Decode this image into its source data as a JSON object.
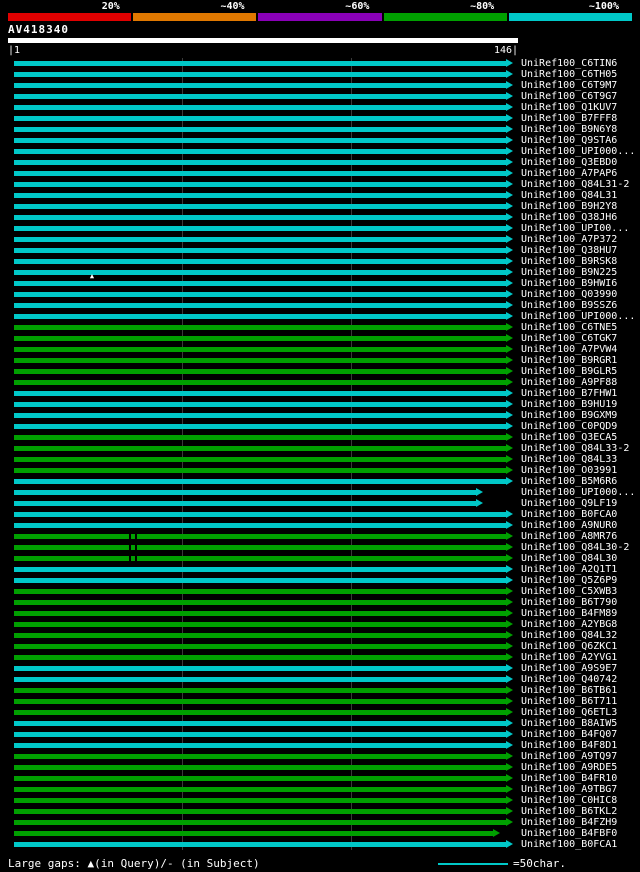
{
  "scale": {
    "labels": [
      "20%",
      "~40%",
      "~60%",
      "~80%",
      "~100%"
    ],
    "colors": [
      "#e00000",
      "#e07800",
      "#8a00b8",
      "#00a000",
      "#00c8c8"
    ]
  },
  "query": {
    "name": "AV418340",
    "ruler_left": "|1",
    "ruler_right": "146|",
    "length": 146
  },
  "bar_colors": {
    "~100%": "#00c8c8",
    "~80%": "#00a000"
  },
  "footer": {
    "gaps_note": "Large gaps: ▲(in Query)/- (in Subject)",
    "legend_label": "=50char.",
    "legend_line_color": "#00c8c8"
  },
  "chart_data": {
    "type": "bar",
    "title": "AV418340",
    "xlabel": "",
    "x_range": [
      1,
      146
    ],
    "grid_ticks": [
      50,
      100
    ],
    "legend_position": "top",
    "identity_bins": [
      "20%",
      "~40%",
      "~60%",
      "~80%",
      "~100%"
    ],
    "rows": [
      {
        "label": "UniRef100_C6TIN6",
        "identity_bin": "~100%",
        "start": 1,
        "end": 146
      },
      {
        "label": "UniRef100_C6TH05",
        "identity_bin": "~100%",
        "start": 1,
        "end": 146
      },
      {
        "label": "UniRef100_C6T9M7",
        "identity_bin": "~100%",
        "start": 1,
        "end": 146
      },
      {
        "label": "UniRef100_C6T9G7",
        "identity_bin": "~100%",
        "start": 1,
        "end": 146
      },
      {
        "label": "UniRef100_Q1KUV7",
        "identity_bin": "~100%",
        "start": 1,
        "end": 146
      },
      {
        "label": "UniRef100_B7FFF8",
        "identity_bin": "~100%",
        "start": 1,
        "end": 146
      },
      {
        "label": "UniRef100_B9N6Y8",
        "identity_bin": "~100%",
        "start": 1,
        "end": 146
      },
      {
        "label": "UniRef100_Q9STA6",
        "identity_bin": "~100%",
        "start": 1,
        "end": 146
      },
      {
        "label": "UniRef100_UPI000...",
        "identity_bin": "~100%",
        "start": 1,
        "end": 146
      },
      {
        "label": "UniRef100_Q3EBD0",
        "identity_bin": "~100%",
        "start": 1,
        "end": 146
      },
      {
        "label": "UniRef100_A7PAP6",
        "identity_bin": "~100%",
        "start": 1,
        "end": 146
      },
      {
        "label": "UniRef100_Q84L31-2",
        "identity_bin": "~100%",
        "start": 1,
        "end": 146
      },
      {
        "label": "UniRef100_Q84L31",
        "identity_bin": "~100%",
        "start": 1,
        "end": 146
      },
      {
        "label": "UniRef100_B9H2Y8",
        "identity_bin": "~100%",
        "start": 1,
        "end": 146
      },
      {
        "label": "UniRef100_Q38JH6",
        "identity_bin": "~100%",
        "start": 1,
        "end": 146
      },
      {
        "label": "UniRef100_UPI00...",
        "identity_bin": "~100%",
        "start": 1,
        "end": 146
      },
      {
        "label": "UniRef100_A7P372",
        "identity_bin": "~100%",
        "start": 1,
        "end": 146
      },
      {
        "label": "UniRef100_Q38HU7",
        "identity_bin": "~100%",
        "start": 1,
        "end": 146
      },
      {
        "label": "UniRef100_B9RSK8",
        "identity_bin": "~100%",
        "start": 1,
        "end": 146
      },
      {
        "label": "UniRef100_B9N225",
        "identity_bin": "~100%",
        "start": 1,
        "end": 146,
        "query_gap_at": 23
      },
      {
        "label": "UniRef100_B9HWI6",
        "identity_bin": "~100%",
        "start": 1,
        "end": 146
      },
      {
        "label": "UniRef100_Q03990",
        "identity_bin": "~100%",
        "start": 1,
        "end": 146
      },
      {
        "label": "UniRef100_B9SSZ6",
        "identity_bin": "~100%",
        "start": 1,
        "end": 146
      },
      {
        "label": "UniRef100_UPI000...",
        "identity_bin": "~100%",
        "start": 1,
        "end": 146
      },
      {
        "label": "UniRef100_C6TNE5",
        "identity_bin": "~80%",
        "start": 1,
        "end": 146
      },
      {
        "label": "UniRef100_C6TGK7",
        "identity_bin": "~80%",
        "start": 1,
        "end": 146
      },
      {
        "label": "UniRef100_A7PVW4",
        "identity_bin": "~80%",
        "start": 1,
        "end": 146
      },
      {
        "label": "UniRef100_B9RGR1",
        "identity_bin": "~80%",
        "start": 1,
        "end": 146
      },
      {
        "label": "UniRef100_B9GLR5",
        "identity_bin": "~80%",
        "start": 1,
        "end": 146
      },
      {
        "label": "UniRef100_A9PF88",
        "identity_bin": "~80%",
        "start": 1,
        "end": 146
      },
      {
        "label": "UniRef100_B7FHW1",
        "identity_bin": "~100%",
        "start": 1,
        "end": 146
      },
      {
        "label": "UniRef100_B9HU19",
        "identity_bin": "~100%",
        "start": 1,
        "end": 146
      },
      {
        "label": "UniRef100_B9GXM9",
        "identity_bin": "~100%",
        "start": 1,
        "end": 146
      },
      {
        "label": "UniRef100_C0PQD9",
        "identity_bin": "~100%",
        "start": 1,
        "end": 146
      },
      {
        "label": "UniRef100_Q3ECA5",
        "identity_bin": "~80%",
        "start": 1,
        "end": 146
      },
      {
        "label": "UniRef100_Q84L33-2",
        "identity_bin": "~80%",
        "start": 1,
        "end": 146
      },
      {
        "label": "UniRef100_Q84L33",
        "identity_bin": "~80%",
        "start": 1,
        "end": 146
      },
      {
        "label": "UniRef100_O03991",
        "identity_bin": "~80%",
        "start": 1,
        "end": 146
      },
      {
        "label": "UniRef100_B5M6R6",
        "identity_bin": "~100%",
        "start": 1,
        "end": 146
      },
      {
        "label": "UniRef100_UPI000...",
        "identity_bin": "~100%",
        "start": 1,
        "end": 137
      },
      {
        "label": "UniRef100_Q9LF19",
        "identity_bin": "~100%",
        "start": 1,
        "end": 137
      },
      {
        "label": "UniRef100_B0FCA0",
        "identity_bin": "~100%",
        "start": 1,
        "end": 146
      },
      {
        "label": "UniRef100_A9NUR0",
        "identity_bin": "~100%",
        "start": 1,
        "end": 146
      },
      {
        "label": "UniRef100_A8MR76",
        "identity_bin": "~80%",
        "start": 1,
        "end": 146,
        "subject_gaps": [
          34,
          36
        ]
      },
      {
        "label": "UniRef100_Q84L30-2",
        "identity_bin": "~80%",
        "start": 1,
        "end": 146,
        "subject_gaps": [
          34,
          36
        ]
      },
      {
        "label": "UniRef100_Q84L30",
        "identity_bin": "~80%",
        "start": 1,
        "end": 146,
        "subject_gaps": [
          34,
          36
        ]
      },
      {
        "label": "UniRef100_A2Q1T1",
        "identity_bin": "~100%",
        "start": 1,
        "end": 146
      },
      {
        "label": "UniRef100_Q5Z6P9",
        "identity_bin": "~100%",
        "start": 1,
        "end": 146
      },
      {
        "label": "UniRef100_C5XWB3",
        "identity_bin": "~80%",
        "start": 1,
        "end": 146
      },
      {
        "label": "UniRef100_B6T790",
        "identity_bin": "~80%",
        "start": 1,
        "end": 146
      },
      {
        "label": "UniRef100_B4FM89",
        "identity_bin": "~80%",
        "start": 1,
        "end": 146
      },
      {
        "label": "UniRef100_A2YBG8",
        "identity_bin": "~80%",
        "start": 1,
        "end": 146
      },
      {
        "label": "UniRef100_Q84L32",
        "identity_bin": "~80%",
        "start": 1,
        "end": 146
      },
      {
        "label": "UniRef100_Q6ZKC1",
        "identity_bin": "~80%",
        "start": 1,
        "end": 146
      },
      {
        "label": "UniRef100_A2YVG1",
        "identity_bin": "~80%",
        "start": 1,
        "end": 146
      },
      {
        "label": "UniRef100_A9S9E7",
        "identity_bin": "~100%",
        "start": 1,
        "end": 146
      },
      {
        "label": "UniRef100_Q40742",
        "identity_bin": "~100%",
        "start": 1,
        "end": 146
      },
      {
        "label": "UniRef100_B6TB61",
        "identity_bin": "~80%",
        "start": 1,
        "end": 146
      },
      {
        "label": "UniRef100_B6T711",
        "identity_bin": "~80%",
        "start": 1,
        "end": 146
      },
      {
        "label": "UniRef100_Q6ETL3",
        "identity_bin": "~80%",
        "start": 1,
        "end": 146
      },
      {
        "label": "UniRef100_B8AIW5",
        "identity_bin": "~100%",
        "start": 1,
        "end": 146
      },
      {
        "label": "UniRef100_B4FQ07",
        "identity_bin": "~100%",
        "start": 1,
        "end": 146
      },
      {
        "label": "UniRef100_B4F8D1",
        "identity_bin": "~100%",
        "start": 1,
        "end": 146
      },
      {
        "label": "UniRef100_A9TQ97",
        "identity_bin": "~80%",
        "start": 1,
        "end": 146
      },
      {
        "label": "UniRef100_A9RDE5",
        "identity_bin": "~80%",
        "start": 1,
        "end": 146
      },
      {
        "label": "UniRef100_B4FR10",
        "identity_bin": "~80%",
        "start": 1,
        "end": 146
      },
      {
        "label": "UniRef100_A9TBG7",
        "identity_bin": "~80%",
        "start": 1,
        "end": 146
      },
      {
        "label": "UniRef100_C0HIC8",
        "identity_bin": "~80%",
        "start": 1,
        "end": 146
      },
      {
        "label": "UniRef100_B6TKL2",
        "identity_bin": "~80%",
        "start": 1,
        "end": 146
      },
      {
        "label": "UniRef100_B4FZH9",
        "identity_bin": "~80%",
        "start": 1,
        "end": 146
      },
      {
        "label": "UniRef100_B4FBF0",
        "identity_bin": "~80%",
        "start": 1,
        "end": 142
      },
      {
        "label": "UniRef100_B0FCA1",
        "identity_bin": "~100%",
        "start": 1,
        "end": 146
      }
    ]
  }
}
